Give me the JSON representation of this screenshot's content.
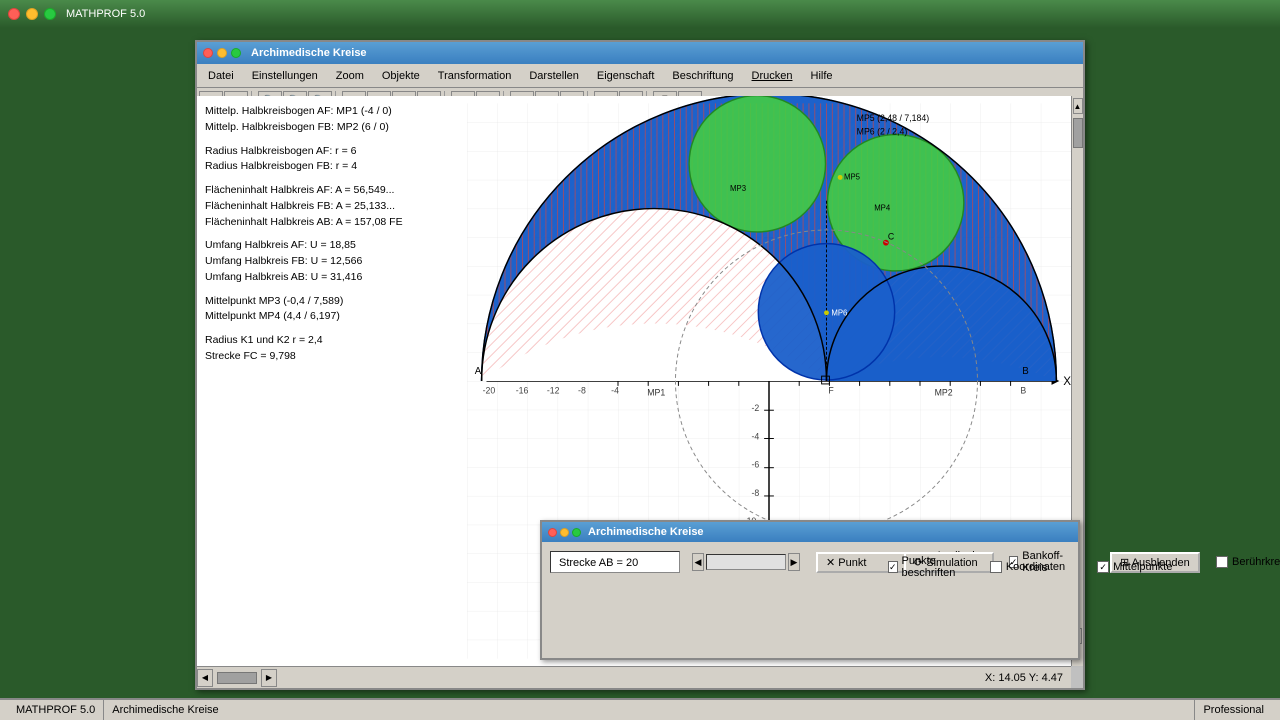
{
  "app": {
    "title": "MATHPROF 5.0",
    "status_left": "MATHPROF 5.0",
    "status_mid": "Archimedische Kreise",
    "status_right": "Professional",
    "coordinates": "X: 14.05   Y: 4.47"
  },
  "main_window": {
    "title": "Archimedische Kreise"
  },
  "menu": {
    "items": [
      "Datei",
      "Einstellungen",
      "Zoom",
      "Objekte",
      "Transformation",
      "Darstellen",
      "Eigenschaft",
      "Beschriftung",
      "Drucken",
      "Hilfe"
    ]
  },
  "info": {
    "line1": "Mittelp. Halbkreisbogen AF: MP1 (-4 / 0)",
    "line2": "Mittelp. Halbkreisbogen FB: MP2 (6 / 0)",
    "line3": "",
    "line4": "Radius Halbkreisbogen AF: r = 6",
    "line5": "Radius Halbkreisbogen FB: r = 4",
    "line6": "",
    "line7": "Flächeninhalt Halbkreis AF: A = 56,549...",
    "line8": "Flächeninhalt Halbkreis FB: A = 25,133...",
    "line9": "Flächeninhalt Halbkreis AB: A = 157,08 FE",
    "line10": "",
    "line11": "Umfang Halbkreis AF: U = 18,85",
    "line12": "Umfang Halbkreis FB: U = 12,566",
    "line13": "Umfang Halbkreis AB: U = 31,416",
    "line14": "",
    "line15": "Mittelpunkt MP3 (-0,4 / 7,589)",
    "line16": "Mittelpunkt MP4 (4,4 / 6,197)",
    "line17": "",
    "line18": "Radius K1 und K2  r = 2,4",
    "line19": "Strecke FC = 9,798"
  },
  "info_right": {
    "mp5": "MP5 (2,48 / 7,184)",
    "mp6": "MP6 (2 / 2,4)"
  },
  "sub_window": {
    "title": "Archimedische Kreise",
    "strecke_label": "Strecke  AB = 20",
    "punkt_btn": "✕ Punkt",
    "simulation_btn": "⟳ Simulation",
    "ausblenden_btn": "⊞ Ausblenden",
    "apollonius_label": "Apollonius-Kreis",
    "bankoff_label": "Bankoff-Kreis",
    "berührkreise_label": "Berührkreise",
    "punkte_label": "Punkte beschriften",
    "koordinaten_label": "Koordinaten",
    "mittelpunkte_label": "Mittelpunkte"
  },
  "toolbar_icons": [
    "grid",
    "measure",
    "zoom-out",
    "zoom-in",
    "zoom-custom",
    "select",
    "rect-select",
    "copy",
    "paste",
    "table",
    "table-add",
    "frame",
    "frame-2",
    "rotate",
    "delete",
    "delete-all",
    "print",
    "help"
  ]
}
